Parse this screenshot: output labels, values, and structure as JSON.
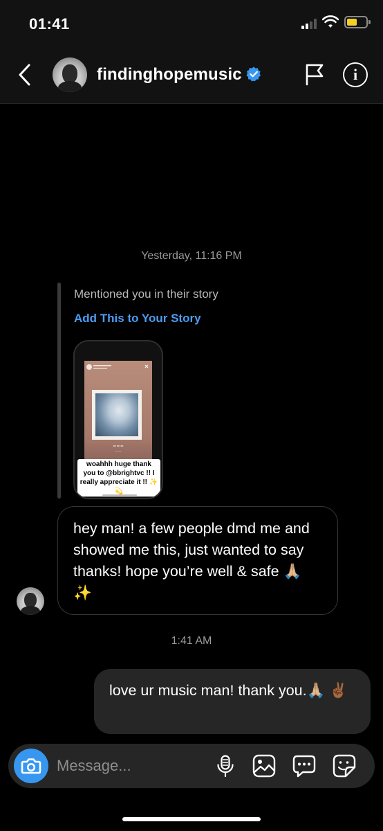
{
  "status_bar": {
    "time": "01:41"
  },
  "header": {
    "username": "findinghopemusic",
    "verified": true,
    "accent_color": "#3797f0"
  },
  "conversation": {
    "timestamp_1": "Yesterday, 11:16 PM",
    "story_mention": {
      "label": "Mentioned you in their story",
      "action_link": "Add This to Your Story",
      "link_color": "#4c9cf0",
      "story_sticker_text": "woahhh huge thank you to @bbrightvc !! I really appreciate it !! ✨💫"
    },
    "received_message": "hey man! a few people dmd me and showed me this, just wanted to say thanks! hope you’re well & safe 🙏🏼 ✨",
    "timestamp_2": "1:41 AM",
    "sent_message": "love ur music man! thank you.🙏🏼 ✌🏾"
  },
  "composer": {
    "placeholder": "Message...",
    "icons": [
      "camera-icon",
      "microphone-icon",
      "gallery-icon",
      "chat-icon",
      "sticker-icon"
    ]
  }
}
